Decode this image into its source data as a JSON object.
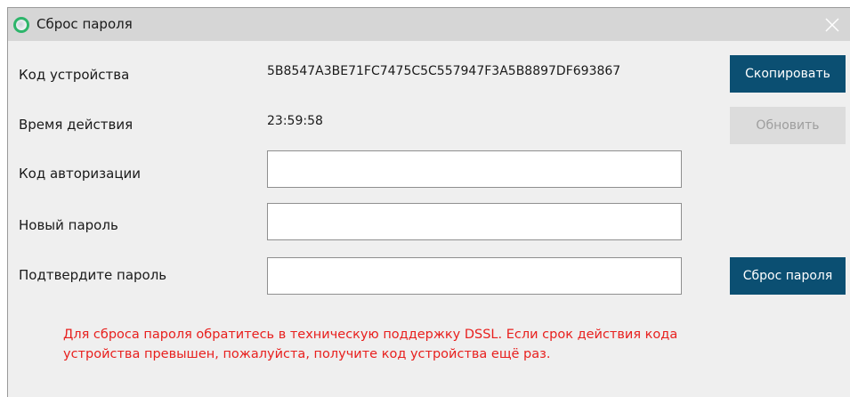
{
  "window": {
    "title": "Сброс пароля",
    "icon": "app-logo-icon",
    "close_icon": "close-icon"
  },
  "device_code": {
    "label": "Код устройства",
    "value": "5B8547A3BE71FC7475C5C557947F3A5B8897DF693867",
    "copy_button": "Скопировать"
  },
  "validity": {
    "label": "Время действия",
    "value": "23:59:58",
    "refresh_button": "Обновить"
  },
  "auth_code": {
    "label": "Код авторизации",
    "value": "",
    "placeholder": ""
  },
  "new_password": {
    "label": "Новый пароль",
    "value": "",
    "placeholder": ""
  },
  "confirm_password": {
    "label": "Подтвердите пароль",
    "value": "",
    "placeholder": "",
    "reset_button": "Сброс пароля"
  },
  "notice": {
    "line1": "Для сброса пароля обратитесь в техническую поддержку DSSL. Если срок действия кода",
    "line2": "устройства превышен, пожалуйста, получите код устройства ещё раз."
  },
  "colors": {
    "primary_button": "#0b4f72",
    "disabled_button": "#dcdcdc",
    "notice_text": "#e8201e",
    "titlebar": "#d6d6d6",
    "background": "#efefef"
  }
}
